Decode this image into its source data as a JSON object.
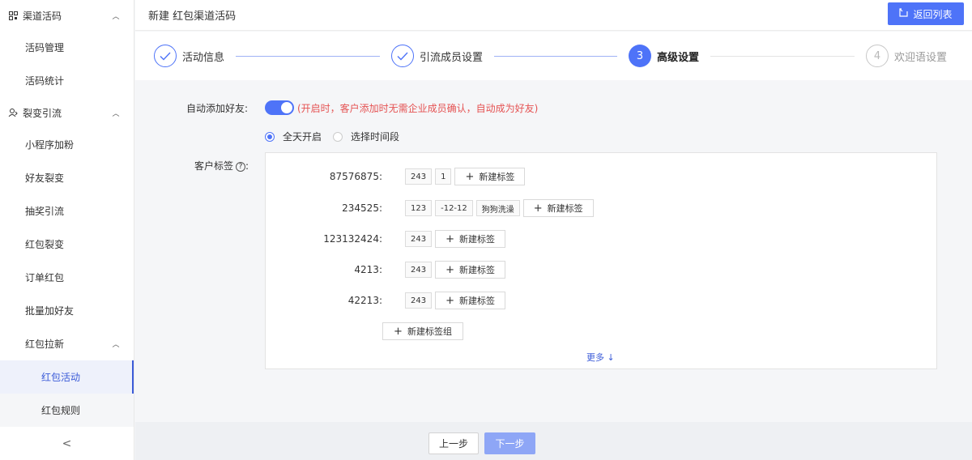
{
  "sidebar": {
    "group1": {
      "label": "渠道活码",
      "icon": "qrcode-icon",
      "expanded": true,
      "items": [
        "活码管理",
        "活码统计"
      ]
    },
    "group2": {
      "label": "裂变引流",
      "icon": "fission-icon",
      "expanded": true,
      "items": [
        "小程序加粉",
        "好友裂变",
        "抽奖引流",
        "红包裂变",
        "订单红包",
        "批量加好友"
      ]
    },
    "subgroup": {
      "label": "红包拉新",
      "expanded": true,
      "items": [
        "红包活动",
        "红包规则"
      ],
      "active": "红包活动"
    },
    "collapse_label": "<"
  },
  "header": {
    "title": "新建 红包渠道活码",
    "back_button": "返回列表"
  },
  "steps": [
    {
      "index": "1",
      "label": "活动信息",
      "state": "done"
    },
    {
      "index": "2",
      "label": "引流成员设置",
      "state": "done"
    },
    {
      "index": "3",
      "label": "高级设置",
      "state": "active"
    },
    {
      "index": "4",
      "label": "欢迎语设置",
      "state": "todo"
    }
  ],
  "form": {
    "auto_add": {
      "label": "自动添加好友:",
      "enabled": true,
      "hint": "(开启时，客户添加时无需企业成员确认，自动成为好友)"
    },
    "time_options": [
      {
        "label": "全天开启",
        "checked": true
      },
      {
        "label": "选择时间段",
        "checked": false
      }
    ],
    "customer_tags": {
      "label": "客户标签",
      "help": "?",
      "groups": [
        {
          "name": "87576875:",
          "tags": [
            "243",
            "1"
          ]
        },
        {
          "name": "234525:",
          "tags": [
            "123",
            "-12-12",
            "狗狗洗澡"
          ]
        },
        {
          "name": "123132424:",
          "tags": [
            "243"
          ]
        },
        {
          "name": "4213:",
          "tags": [
            "243"
          ]
        },
        {
          "name": "42213:",
          "tags": [
            "243"
          ]
        }
      ],
      "new_tag_label": "新建标签",
      "new_group_label": "新建标签组",
      "more_label": "更多 ↓"
    }
  },
  "footer": {
    "prev_label": "上一步",
    "next_label": "下一步"
  },
  "colors": {
    "primary": "#4e73f8",
    "hint": "#e55353",
    "next_disabled": "#8ea6f6"
  }
}
